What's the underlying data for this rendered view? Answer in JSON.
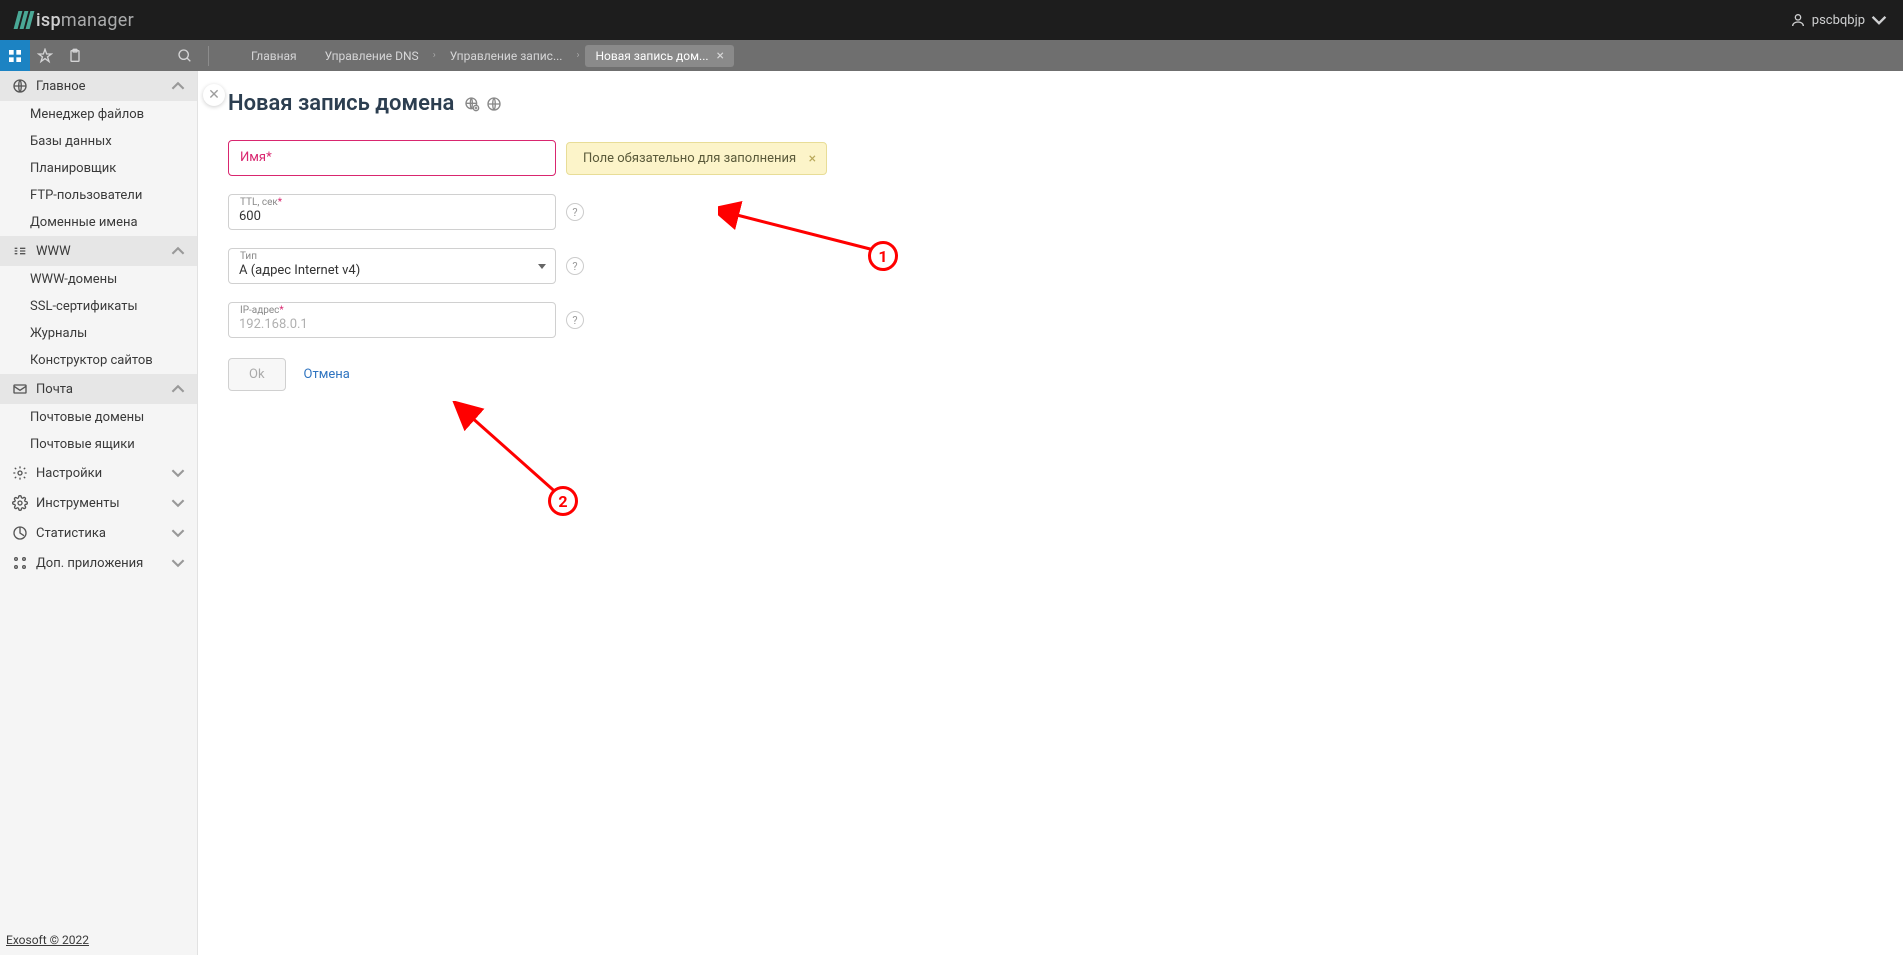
{
  "header": {
    "logo_text_pre": "isp",
    "logo_text_post": "manager",
    "username": "pscbqbjp"
  },
  "breadcrumbs": {
    "items": [
      "Главная",
      "Управление DNS",
      "Управление запис..."
    ],
    "active_tab": "Новая запись дом..."
  },
  "sidebar": {
    "groups": [
      {
        "id": "main",
        "label": "Главное",
        "expanded": true,
        "items": [
          "Менеджер файлов",
          "Базы данных",
          "Планировщик",
          "FTP-пользователи",
          "Доменные имена"
        ]
      },
      {
        "id": "www",
        "label": "WWW",
        "expanded": true,
        "items": [
          "WWW-домены",
          "SSL-сертификаты",
          "Журналы",
          "Конструктор сайтов"
        ]
      },
      {
        "id": "mail",
        "label": "Почта",
        "expanded": true,
        "items": [
          "Почтовые домены",
          "Почтовые ящики"
        ]
      },
      {
        "id": "settings",
        "label": "Настройки",
        "expanded": false,
        "items": []
      },
      {
        "id": "tools",
        "label": "Инструменты",
        "expanded": false,
        "items": []
      },
      {
        "id": "stats",
        "label": "Статистика",
        "expanded": false,
        "items": []
      },
      {
        "id": "apps",
        "label": "Доп. приложения",
        "expanded": false,
        "items": []
      }
    ]
  },
  "footer": {
    "copyright": "Exosoft © 2022"
  },
  "page": {
    "title": "Новая запись домена",
    "form": {
      "name": {
        "label": "Имя",
        "value": ""
      },
      "ttl": {
        "label": "TTL, сек",
        "value": "600"
      },
      "type": {
        "label": "Тип",
        "value": "A (адрес Internet v4)"
      },
      "ip": {
        "label": "IP-адрес",
        "placeholder": "192.168.0.1",
        "value": ""
      }
    },
    "warning": "Поле обязательно для заполнения",
    "buttons": {
      "ok": "Ok",
      "cancel": "Отмена"
    }
  },
  "annotations": {
    "one": "1",
    "two": "2"
  }
}
